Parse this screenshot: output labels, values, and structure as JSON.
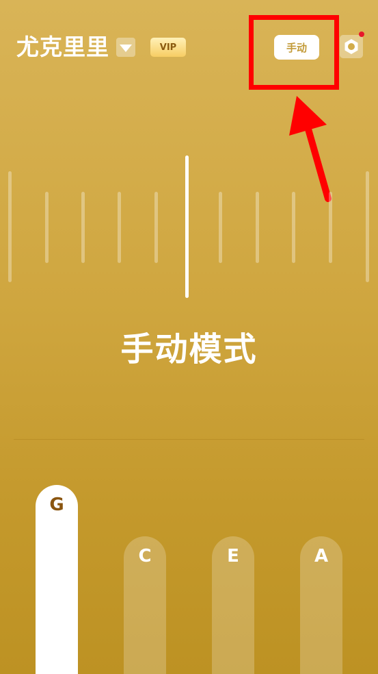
{
  "header": {
    "instrument_name": "尤克里里",
    "vip_label": "VIP",
    "mode_button_label": "手动"
  },
  "tuner": {
    "mode_text": "手动模式"
  },
  "strings": [
    {
      "note": "G",
      "active": true
    },
    {
      "note": "C",
      "active": false
    },
    {
      "note": "E",
      "active": false
    },
    {
      "note": "A",
      "active": false
    }
  ],
  "colors": {
    "background_top": "#d9b457",
    "background_bottom": "#bd9223",
    "mode_button_text": "#c29a37",
    "active_note_text": "#8a5510",
    "annotation": "#ff0000",
    "notification_dot": "#e8172a"
  },
  "icons": {
    "dropdown": "triangle-down-icon",
    "settings": "gear-icon"
  }
}
